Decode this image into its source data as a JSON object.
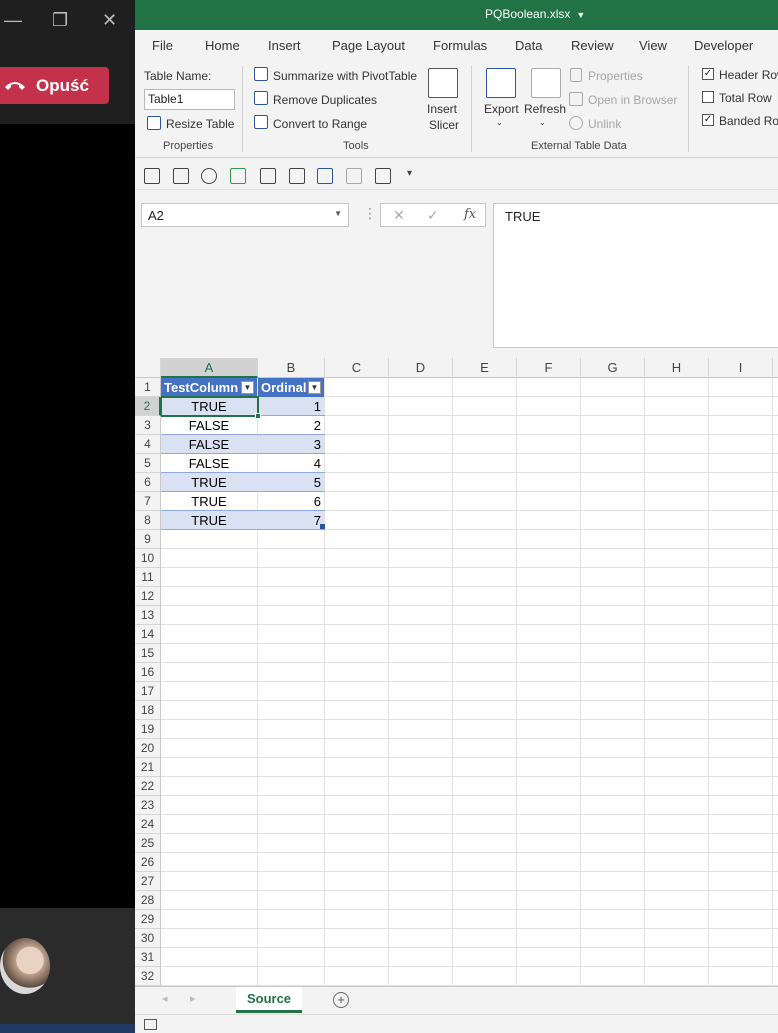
{
  "teams": {
    "leave_label": "Opuść"
  },
  "window": {
    "title": "PQBoolean.xlsx"
  },
  "ribbon_tabs": [
    "File",
    "Home",
    "Insert",
    "Page Layout",
    "Formulas",
    "Data",
    "Review",
    "View",
    "Developer"
  ],
  "ribbon": {
    "table_name_label": "Table Name:",
    "table_name_value": "Table1",
    "resize_table": "Resize Table",
    "properties_group": "Properties",
    "summarize_pivot": "Summarize with PivotTable",
    "remove_duplicates": "Remove Duplicates",
    "convert_to_range": "Convert to Range",
    "tools_group": "Tools",
    "insert_slicer_line1": "Insert",
    "insert_slicer_line2": "Slicer",
    "export": "Export",
    "refresh": "Refresh",
    "properties": "Properties",
    "open_in_browser": "Open in Browser",
    "unlink": "Unlink",
    "external_group": "External Table Data",
    "header_row": "Header Row",
    "total_row": "Total Row",
    "banded_rows": "Banded Rows"
  },
  "formula_bar": {
    "name_box": "A2",
    "formula": "TRUE",
    "fx": "fx"
  },
  "columns": [
    "A",
    "B",
    "C",
    "D",
    "E",
    "F",
    "G",
    "H",
    "I"
  ],
  "table": {
    "headers": [
      "TestColumn",
      "Ordinal"
    ],
    "rows": [
      {
        "test": "TRUE",
        "ordinal": "1"
      },
      {
        "test": "FALSE",
        "ordinal": "2"
      },
      {
        "test": "FALSE",
        "ordinal": "3"
      },
      {
        "test": "FALSE",
        "ordinal": "4"
      },
      {
        "test": "TRUE",
        "ordinal": "5"
      },
      {
        "test": "TRUE",
        "ordinal": "6"
      },
      {
        "test": "TRUE",
        "ordinal": "7"
      }
    ]
  },
  "row_count": 32,
  "sheet": {
    "name": "Source"
  }
}
